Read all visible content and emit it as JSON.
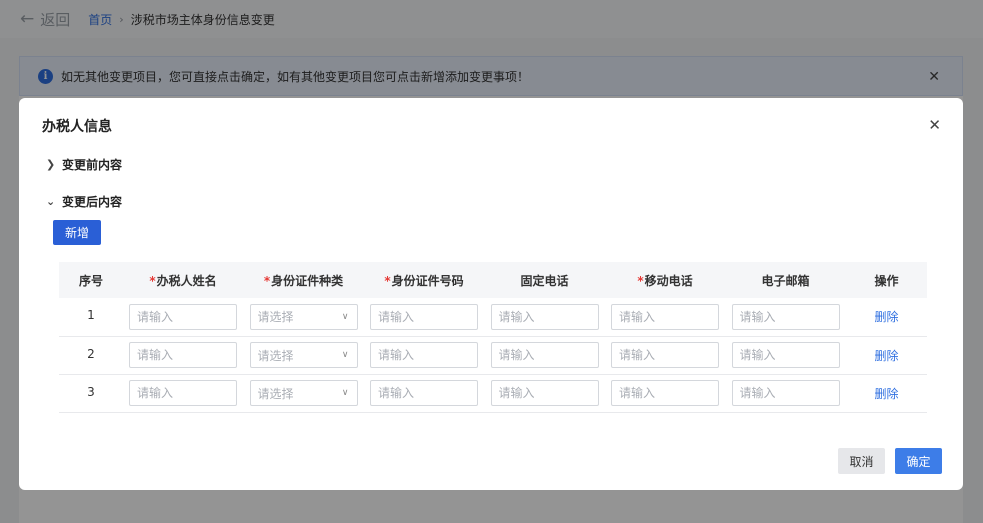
{
  "topbar": {
    "back_label": "返回",
    "breadcrumb_home": "首页",
    "breadcrumb_current": "涉税市场主体身份信息变更"
  },
  "alert": {
    "text": "如无其他变更项目，您可直接点击确定，如有其他变更项目您可点击新增添加变更事项！"
  },
  "modal": {
    "title": "办税人信息",
    "section_before": "变更前内容",
    "section_after": "变更后内容",
    "add_label": "新增",
    "columns": [
      "序号",
      "办税人姓名",
      "身份证件种类",
      "身份证件号码",
      "固定电话",
      "移动电话",
      "电子邮箱",
      "操作"
    ],
    "input_placeholder": "请输入",
    "select_placeholder": "请选择",
    "delete_label": "删除",
    "rows": [
      {
        "index": "1"
      },
      {
        "index": "2"
      },
      {
        "index": "3"
      }
    ],
    "cancel_label": "取消",
    "confirm_label": "确定"
  }
}
